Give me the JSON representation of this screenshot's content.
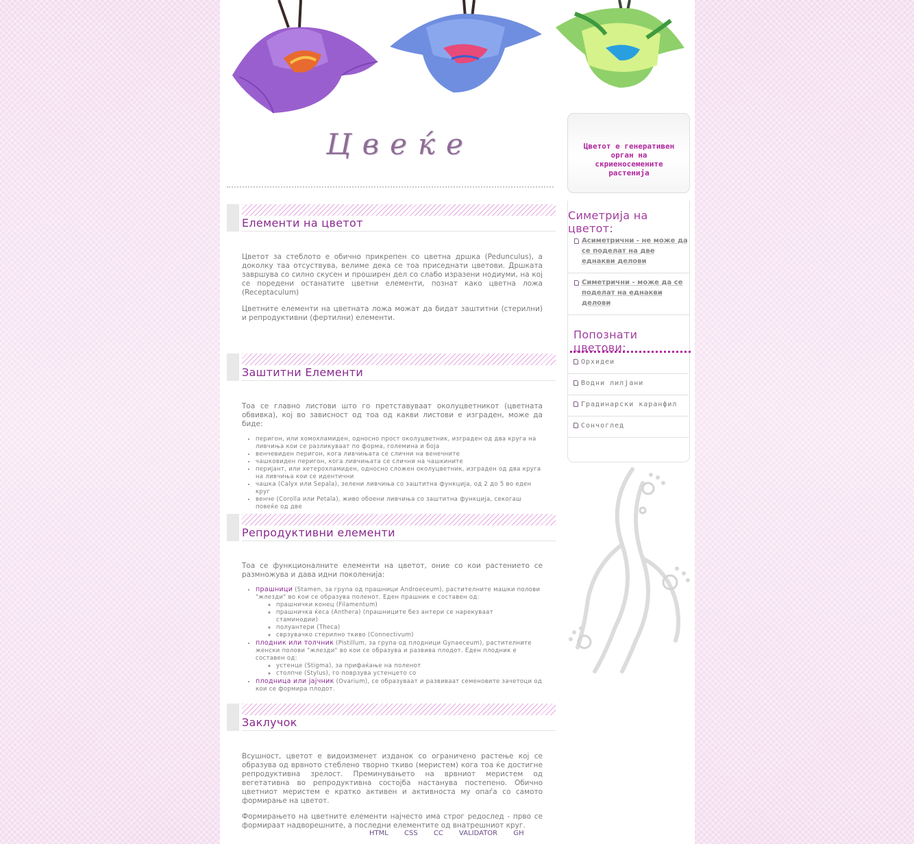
{
  "logo": {
    "text": "Цвеќе"
  },
  "sections": [
    {
      "title": "Елементи на цветот",
      "paragraphs": [
        "Цветот за стеблото е обично прикрепен со цветна дршка (Pedunculus), а доколку таа отсуствува, велиме дека се тоа приседнати цветови. Дршката завршува со силно скусен и проширен дел со слабо изразени нодиуми, на кој се поредени останатите цветни елементи, познат како цветна ложа (Receptaculum)",
        "Цветните елементи на цветната ложа можат да бидат заштитни (стерилни) и репродуктивни (фертилни) елементи."
      ]
    },
    {
      "title": "Заштитни Елементи",
      "paragraphs": [
        "Тоа се главно листови што го претставуваат околуцветникот (цветната обвивка), кој во зависност од тоа од какви листови е изграден, може да биде:"
      ],
      "items": [
        "перигон, или хомохламиден, односно прост околуцветник, изграден од два круга на ливчиња кои се разликуваат по форма, големина и боја",
        "венчевиден перигон, кога ливчињата се слични на венечните",
        "чашковиден перигон, кога ливчињата се слични на чашкините",
        "перијант, или хетерохламиден, односно сложен околуцветник, изграден од два круга на ливчиња кои се идентични",
        "чашка (Calyx или Sepala), зелени ливчиња со заштитна функција, од 2 до 5 во еден круг",
        "венче (Corolla или Petala), живо обоени ливчиња со заштитна функција, секогаш повеќе од две"
      ]
    },
    {
      "title": "Репродуктивни елементи",
      "paragraphs": [
        "Тоа се функционалните елементи на цветот, оние со кои растението се размножува и дава идни поколенија:"
      ],
      "items": [
        {
          "term": "прашници",
          "text": " (Stamen, за група од прашници Androeceum), растителните машки полови \"жлезди\" во кои се образува поленот. Еден прашник е составен од:",
          "sub": [
            "прашнички конец (Filamentum)",
            "прашничка ќеса (Anthera) (прашниците без антери се нарекуваат стаминодии)",
            "полуантери (Theca)",
            "сврзувачко стерилно ткиво (Connectivum)"
          ]
        },
        {
          "term": "плодник или толчник",
          "text": " (Pistillum, за група од плодници Gynaeceum), растителните женски полови \"жлезди\" во кои се образува и развива плодот. Еден плодник е составен од:",
          "sub": [
            "устенце (Stigma), за прифаќање на поленот",
            "столпче (Stylus), го поврзува устенцето со"
          ]
        },
        {
          "term": "плодница или јајчник",
          "text": " (Ovarium), се образуваат и развиваат семеновите зачетоци од кои се формира плодот.",
          "sub": []
        }
      ]
    },
    {
      "title": "Заклучок",
      "paragraphs": [
        "Всушност, цветот е видоизменет изданок со ограничено растење кој се образува од врвното стеблено творно ткиво (меристем) кога тоа ќе достигне репродуктивна зрелост. Преминувањето на врвниот меристем од вегетативна во репродуктивна состојба настанува постепено. Обично цветниот меристем е кратко активен и активноста му опаѓа со самото формирање на цветот.",
        "Формирањето на цветните елементи најчесто има строг редослед - прво се формираат надворешните, а последни елементите од внатрешниот круг."
      ]
    }
  ],
  "footer": {
    "links": [
      "HTML",
      "CSS",
      "CC",
      "VALIDATOR",
      "GH"
    ]
  },
  "sidebar": {
    "quote": "Цветот е генеративен орган на скриеносемените растенија",
    "symmetry_title": "Симетрија на цветот:",
    "symmetry_items": [
      "Асиметрични - не може да се поделат на две еднакви делови",
      "Симетрични - може да се поделат на еднакви делови"
    ],
    "flowers_title": "Попознати цветови:",
    "flowers": [
      "Орхидеи",
      "Водни лилјани",
      "Градинарски каранфил",
      "Сончоглед"
    ]
  },
  "colors": {
    "accent": "#8a2a8f",
    "highlight": "#b0279d",
    "text": "#7a7a7a"
  }
}
